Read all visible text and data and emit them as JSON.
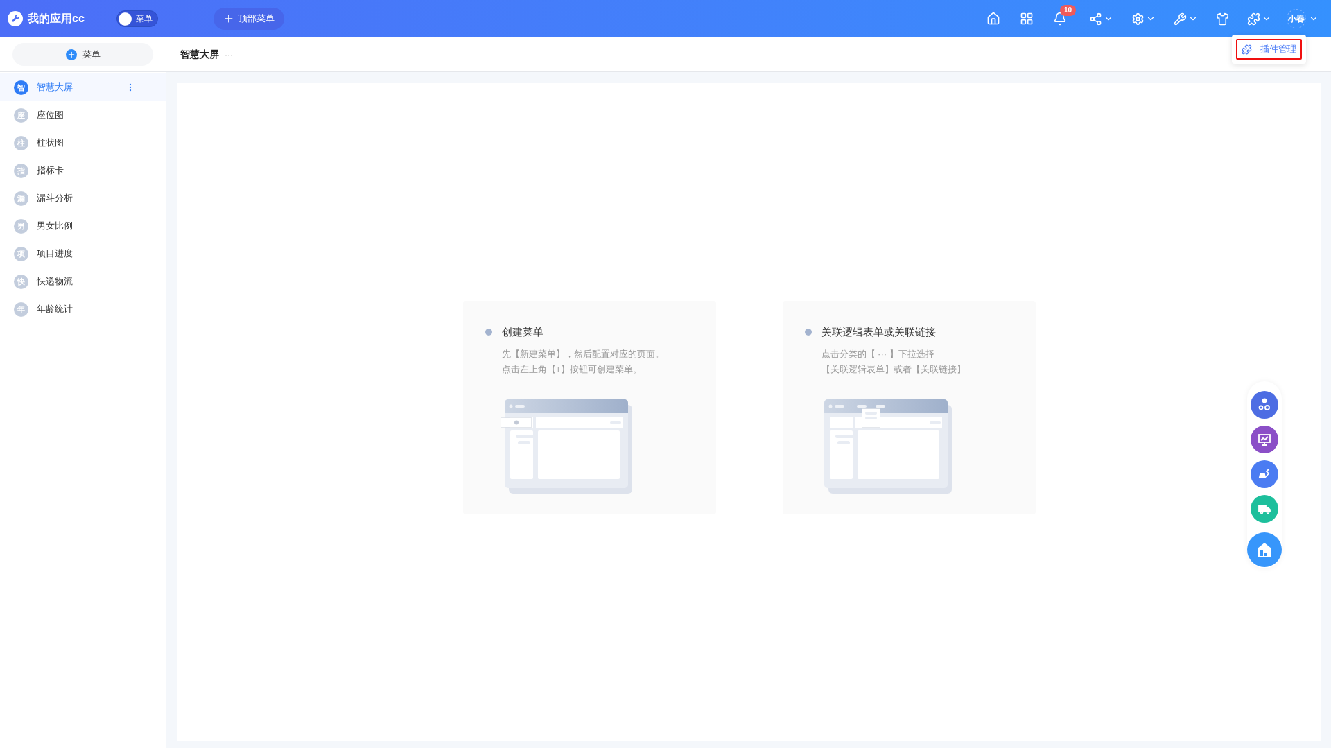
{
  "app": {
    "title": "我的应用cc"
  },
  "menu_toggle": {
    "label": "菜单",
    "on": false
  },
  "top_menu_button": {
    "label": "顶部菜单"
  },
  "notifications": {
    "count": "10"
  },
  "plugin_dropdown": {
    "items": [
      {
        "label": "插件管理",
        "selected": true
      }
    ]
  },
  "user": {
    "avatar_text": "小春"
  },
  "sidebar": {
    "add_button": "菜单",
    "items": [
      {
        "badge": "智",
        "label": "智慧大屏",
        "selected": true
      },
      {
        "badge": "座",
        "label": "座位图",
        "selected": false
      },
      {
        "badge": "柱",
        "label": "柱状图",
        "selected": false
      },
      {
        "badge": "指",
        "label": "指标卡",
        "selected": false
      },
      {
        "badge": "漏",
        "label": "漏斗分析",
        "selected": false
      },
      {
        "badge": "男",
        "label": "男女比例",
        "selected": false
      },
      {
        "badge": "项",
        "label": "项目进度",
        "selected": false
      },
      {
        "badge": "快",
        "label": "快递物流",
        "selected": false
      },
      {
        "badge": "年",
        "label": "年龄统计",
        "selected": false
      }
    ]
  },
  "breadcrumb": {
    "title": "智慧大屏",
    "more": "···"
  },
  "guide_cards": [
    {
      "kind": "create",
      "title": "创建菜单",
      "lines": [
        "先【新建菜单】，然后配置对应的页面。",
        "点击左上角【+】按钮可创建菜单。"
      ]
    },
    {
      "kind": "link",
      "title": "关联逻辑表单或关联链接",
      "lines": [
        "点击分类的【 ··· 】下拉选择",
        "【关联逻辑表单】或者【关联链接】"
      ]
    }
  ]
}
